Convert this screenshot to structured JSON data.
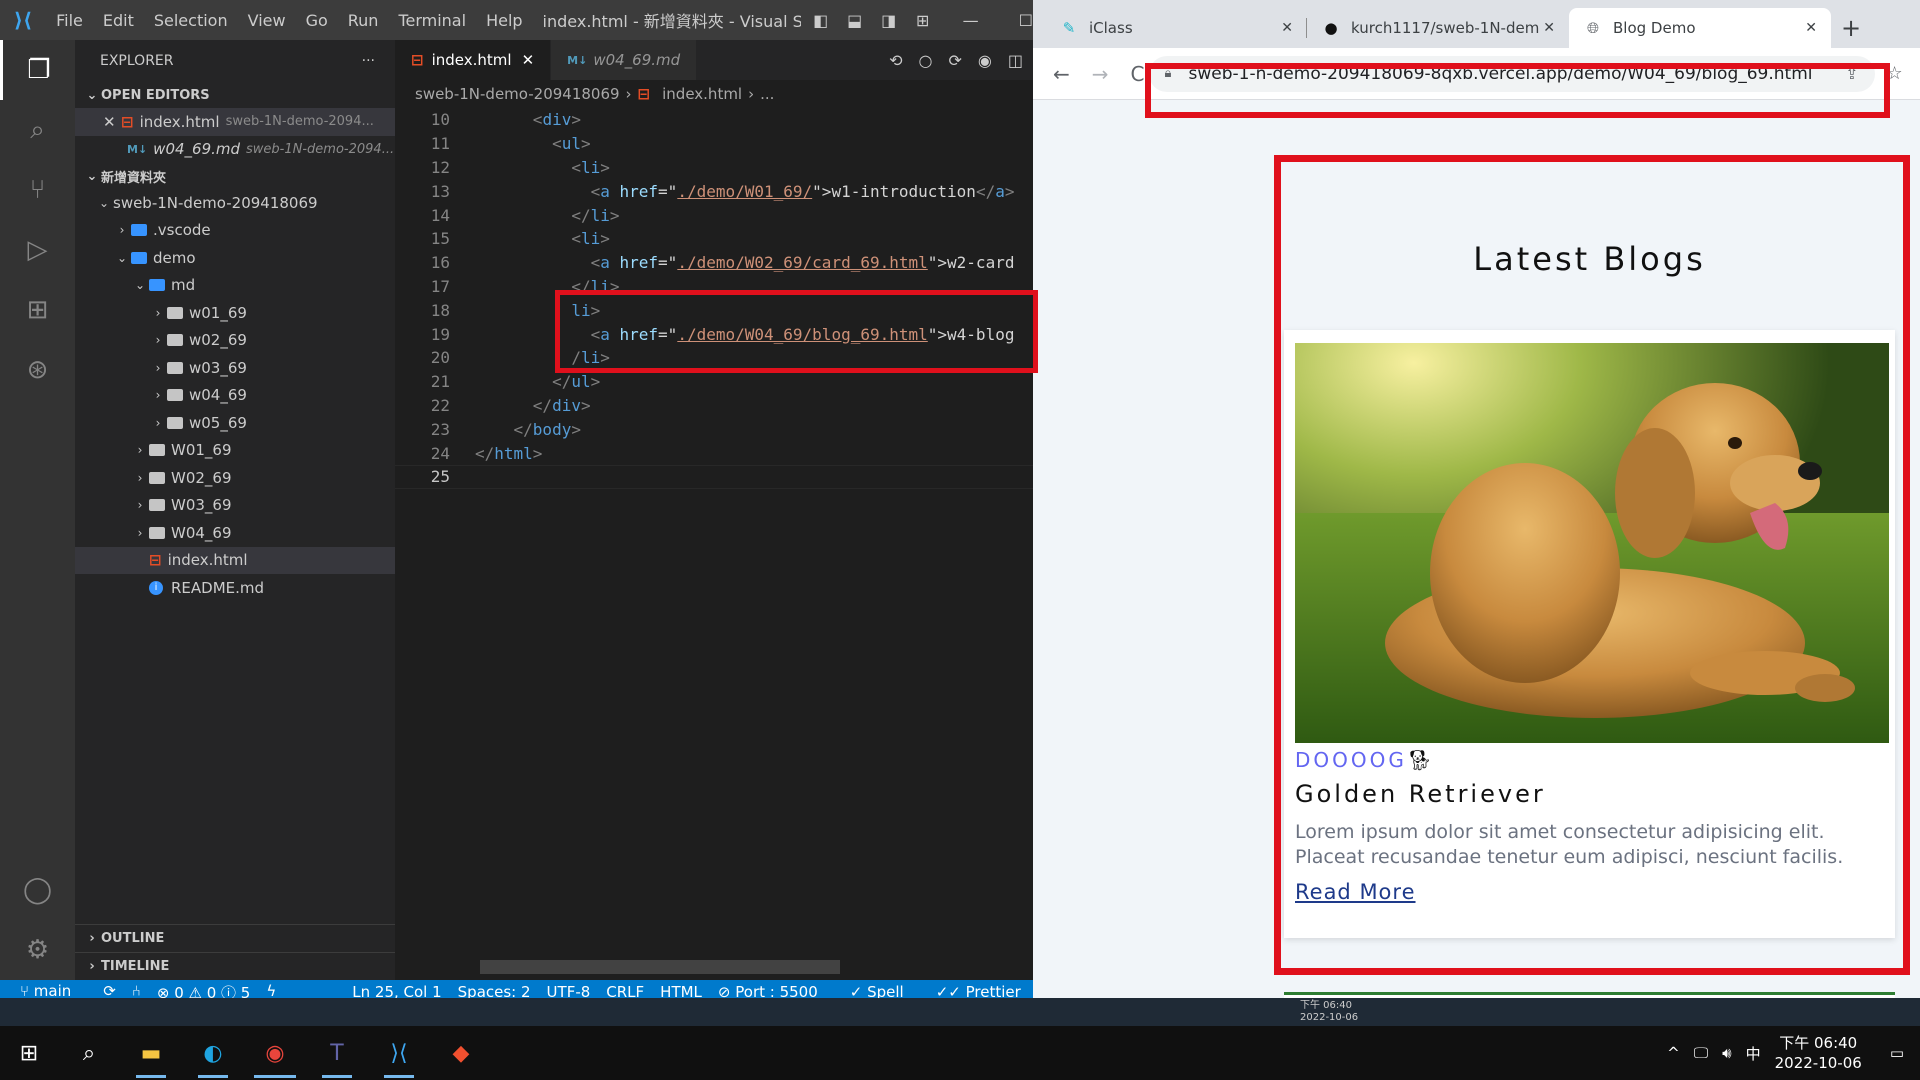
{
  "vscode": {
    "menu": [
      "File",
      "Edit",
      "Selection",
      "View",
      "Go",
      "Run",
      "Terminal",
      "Help"
    ],
    "window_title": "index.html - 新增資料夾 - Visual Studio...",
    "explorer_title": "EXPLORER",
    "open_editors_label": "OPEN EDITORS",
    "open_editors": [
      {
        "name": "index.html",
        "desc": "sweb-1N-demo-2094..."
      },
      {
        "name": "w04_69.md",
        "desc": "sweb-1N-demo-2094..."
      }
    ],
    "workspace_label": "新增資料夾",
    "tree": [
      {
        "label": "sweb-1N-demo-209418069"
      },
      {
        "label": ".vscode"
      },
      {
        "label": "demo"
      },
      {
        "label": "md"
      },
      {
        "label": "w01_69"
      },
      {
        "label": "w02_69"
      },
      {
        "label": "w03_69"
      },
      {
        "label": "w04_69"
      },
      {
        "label": "w05_69"
      },
      {
        "label": "W01_69"
      },
      {
        "label": "W02_69"
      },
      {
        "label": "W03_69"
      },
      {
        "label": "W04_69"
      },
      {
        "label": "index.html"
      },
      {
        "label": "README.md"
      }
    ],
    "outline_label": "OUTLINE",
    "timeline_label": "TIMELINE",
    "tabs": [
      {
        "label": "index.html",
        "icon": "html-file-icon"
      },
      {
        "label": "w04_69.md",
        "icon": "markdown-file-icon"
      }
    ],
    "breadcrumb": [
      "sweb-1N-demo-209418069",
      "index.html",
      "..."
    ],
    "code_lines": [
      {
        "n": "10",
        "indent": "      ",
        "parts": [
          [
            "tk-punc",
            "<"
          ],
          [
            "tk-tag",
            "div"
          ],
          [
            "tk-punc",
            ">"
          ]
        ]
      },
      {
        "n": "11",
        "indent": "        ",
        "parts": [
          [
            "tk-punc",
            "<"
          ],
          [
            "tk-tag",
            "ul"
          ],
          [
            "tk-punc",
            ">"
          ]
        ]
      },
      {
        "n": "12",
        "indent": "          ",
        "parts": [
          [
            "tk-punc",
            "<"
          ],
          [
            "tk-tag",
            "li"
          ],
          [
            "tk-punc",
            ">"
          ]
        ]
      },
      {
        "n": "13",
        "indent": "            ",
        "parts": [
          [
            "tk-punc",
            "<"
          ],
          [
            "tk-tag",
            "a"
          ],
          [
            "tk-txt",
            " "
          ],
          [
            "tk-attr",
            "href"
          ],
          [
            "tk-txt",
            "=\""
          ],
          [
            "tk-str",
            "./demo/W01_69/"
          ],
          [
            "tk-txt",
            "\">w1-introduction"
          ],
          [
            "tk-punc",
            "</"
          ],
          [
            "tk-tag",
            "a"
          ],
          [
            "tk-punc",
            ">"
          ]
        ]
      },
      {
        "n": "14",
        "indent": "          ",
        "parts": [
          [
            "tk-punc",
            "</"
          ],
          [
            "tk-tag",
            "li"
          ],
          [
            "tk-punc",
            ">"
          ]
        ]
      },
      {
        "n": "15",
        "indent": "          ",
        "parts": [
          [
            "tk-punc",
            "<"
          ],
          [
            "tk-tag",
            "li"
          ],
          [
            "tk-punc",
            ">"
          ]
        ]
      },
      {
        "n": "16",
        "indent": "            ",
        "parts": [
          [
            "tk-punc",
            "<"
          ],
          [
            "tk-tag",
            "a"
          ],
          [
            "tk-txt",
            " "
          ],
          [
            "tk-attr",
            "href"
          ],
          [
            "tk-txt",
            "=\""
          ],
          [
            "tk-str",
            "./demo/W02_69/card_69.html"
          ],
          [
            "tk-txt",
            "\">w2-card"
          ]
        ]
      },
      {
        "n": "17",
        "indent": "          ",
        "parts": [
          [
            "tk-punc",
            "</"
          ],
          [
            "tk-tag",
            "li"
          ],
          [
            "tk-punc",
            ">"
          ]
        ]
      },
      {
        "n": "18",
        "indent": "          ",
        "parts": [
          [
            "tk-tag",
            "li"
          ],
          [
            "tk-punc",
            ">"
          ]
        ]
      },
      {
        "n": "19",
        "indent": "            ",
        "parts": [
          [
            "tk-punc",
            "<"
          ],
          [
            "tk-tag",
            "a"
          ],
          [
            "tk-txt",
            " "
          ],
          [
            "tk-attr",
            "href"
          ],
          [
            "tk-txt",
            "=\""
          ],
          [
            "tk-str",
            "./demo/W04_69/blog_69.html"
          ],
          [
            "tk-txt",
            "\">w4-blog"
          ]
        ]
      },
      {
        "n": "20",
        "indent": "          ",
        "parts": [
          [
            "tk-punc",
            "/"
          ],
          [
            "tk-tag",
            "li"
          ],
          [
            "tk-punc",
            ">"
          ]
        ]
      },
      {
        "n": "21",
        "indent": "        ",
        "parts": [
          [
            "tk-punc",
            "</"
          ],
          [
            "tk-tag",
            "ul"
          ],
          [
            "tk-punc",
            ">"
          ]
        ]
      },
      {
        "n": "22",
        "indent": "      ",
        "parts": [
          [
            "tk-punc",
            "</"
          ],
          [
            "tk-tag",
            "div"
          ],
          [
            "tk-punc",
            ">"
          ]
        ]
      },
      {
        "n": "23",
        "indent": "    ",
        "parts": [
          [
            "tk-punc",
            "</"
          ],
          [
            "tk-tag",
            "body"
          ],
          [
            "tk-punc",
            ">"
          ]
        ]
      },
      {
        "n": "24",
        "indent": "",
        "parts": [
          [
            "tk-punc",
            "</"
          ],
          [
            "tk-tag",
            "html"
          ],
          [
            "tk-punc",
            ">"
          ]
        ]
      },
      {
        "n": "25",
        "indent": "",
        "parts": []
      }
    ],
    "status": {
      "branch": "main",
      "problems": "⊗ 0 ⚠ 0 ⓘ 5",
      "position": "Ln 25, Col 1",
      "spaces": "Spaces: 2",
      "encoding": "UTF-8",
      "eol": "CRLF",
      "language": "HTML",
      "port": "Port : 5500",
      "spell": "Spell",
      "prettier": "Prettier"
    }
  },
  "browser": {
    "tabs": [
      {
        "label": "iClass",
        "icon": "iclass-icon",
        "active": false
      },
      {
        "label": "kurch1117/sweb-1N-dem",
        "icon": "github-icon",
        "active": false
      },
      {
        "label": "Blog Demo",
        "icon": "globe-icon",
        "active": true
      }
    ],
    "url": "sweb-1-n-demo-209418069-8qxb.vercel.app/demo/W04_69/blog_69.html",
    "page": {
      "title": "Latest Blogs",
      "card": {
        "tag": "DOOOOG",
        "heading": "Golden Retriever",
        "text": "Lorem ipsum dolor sit amet consectetur adipisicing elit. Placeat recusandae tenetur eum adipisci, nesciunt facilis.",
        "link": "Read More"
      }
    }
  },
  "taskbar": {
    "time": "下午 06:40",
    "date": "2022-10-06",
    "ime": "中",
    "ghost_time": "下午 06:40",
    "ghost_date": "2022-10-06"
  },
  "colors": {
    "highlight": "#e0101c",
    "vscode_status": "#007acc",
    "accent_indigo": "#6366f1"
  }
}
